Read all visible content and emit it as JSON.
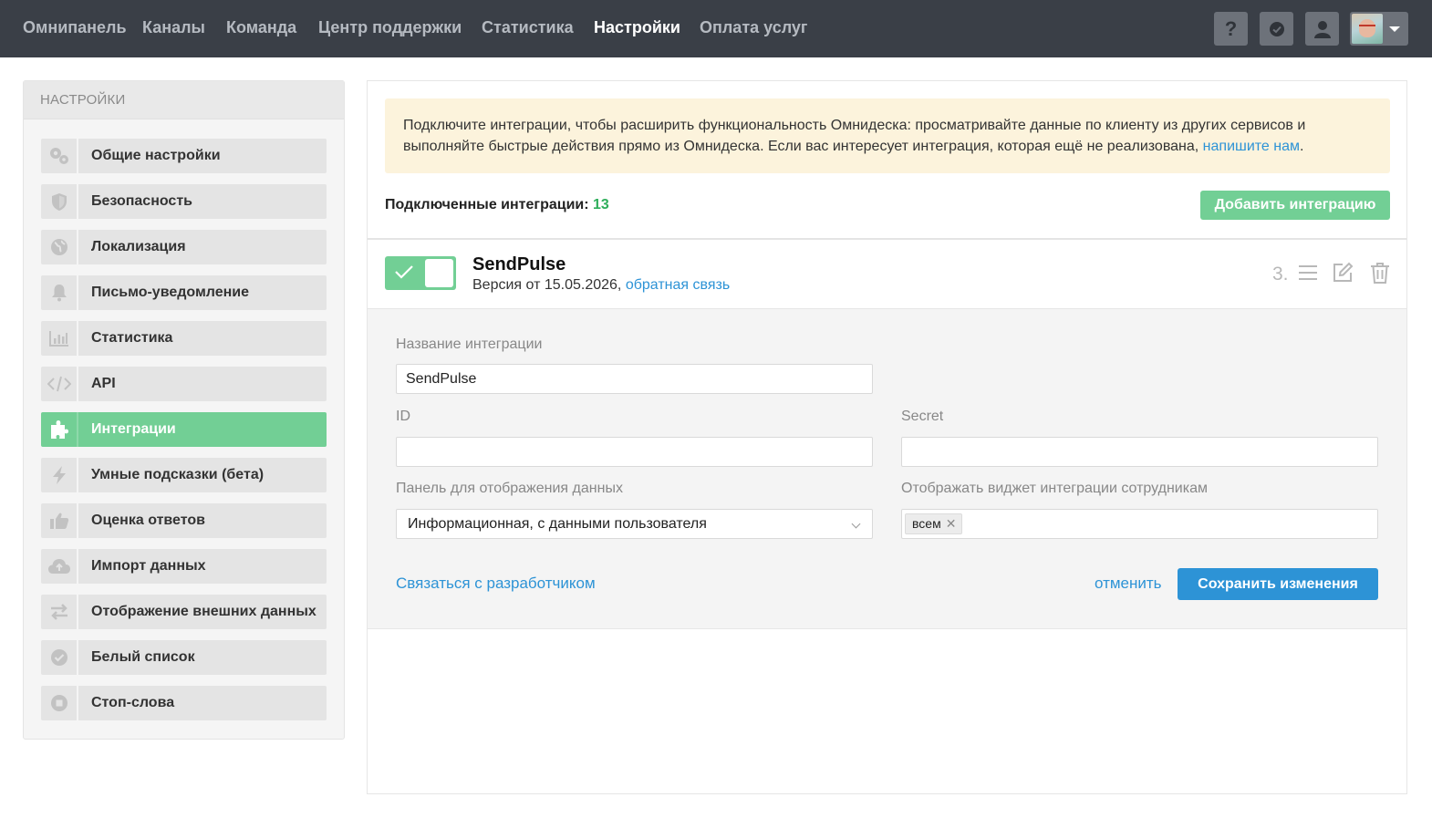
{
  "nav": {
    "items": [
      "Омнипанель",
      "Каналы",
      "Команда",
      "Центр поддержки",
      "Статистика",
      "Настройки",
      "Оплата услуг"
    ],
    "active": "Настройки",
    "help_label": "?"
  },
  "sidebar": {
    "header": "НАСТРОЙКИ",
    "items": [
      {
        "label": "Общие настройки",
        "icon": "gears-icon"
      },
      {
        "label": "Безопасность",
        "icon": "shield-icon"
      },
      {
        "label": "Локализация",
        "icon": "globe-icon"
      },
      {
        "label": "Письмо-уведомление",
        "icon": "bell-icon"
      },
      {
        "label": "Статистика",
        "icon": "bar-chart-icon"
      },
      {
        "label": "API",
        "icon": "code-icon"
      },
      {
        "label": "Интеграции",
        "icon": "puzzle-icon"
      },
      {
        "label": "Умные подсказки (бета)",
        "icon": "bolt-icon"
      },
      {
        "label": "Оценка ответов",
        "icon": "thumbs-up-icon"
      },
      {
        "label": "Импорт данных",
        "icon": "cloud-upload-icon"
      },
      {
        "label": "Отображение внешних данных",
        "icon": "exchange-icon"
      },
      {
        "label": "Белый список",
        "icon": "check-badge-icon"
      },
      {
        "label": "Стоп-слова",
        "icon": "stop-icon"
      }
    ],
    "active_index": 6
  },
  "notice": {
    "text": "Подключите интеграции, чтобы расширить функциональность Омнидеска: просматривайте данные по клиенту из других сервисов и выполняйте быстрые действия прямо из Омнидеска. Если вас интересует интеграция, которая ещё не реализована,",
    "link": "напишите нам",
    "end": "."
  },
  "connected": {
    "label": "Подключенные интеграции:",
    "count": "13",
    "add_button": "Добавить интеграцию"
  },
  "integration": {
    "enabled": true,
    "title": "SendPulse",
    "version_text": "Версия от 15.05.2026,",
    "feedback_link": "обратная связь",
    "position": "3."
  },
  "form": {
    "name_label": "Название интеграции",
    "name_value": "SendPulse",
    "id_label": "ID",
    "id_value": "",
    "secret_label": "Secret",
    "secret_value": "",
    "panel_label": "Панель для отображения данных",
    "panel_value": "Информационная, с данными пользователя",
    "widget_label": "Отображать виджет интеграции сотрудникам",
    "widget_tag": "всем",
    "contact_link": "Связаться с разработчиком",
    "cancel": "отменить",
    "save": "Сохранить изменения"
  },
  "colors": {
    "topbar": "#3a3f47",
    "accent_green": "#72cf95",
    "link_blue": "#2d93d6",
    "notice_bg": "#fcf3dc"
  }
}
